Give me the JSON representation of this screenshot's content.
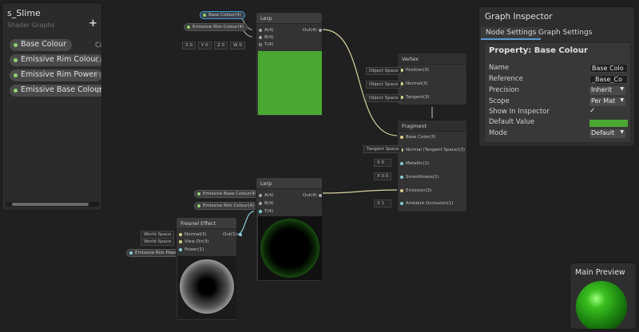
{
  "blackboard": {
    "title": "s_Slime",
    "subtitle": "Shader Graphs",
    "add": "+",
    "properties": [
      {
        "name": "Base Colour",
        "type": "Col"
      },
      {
        "name": "Emissive Rim Colour",
        "type": "Col"
      },
      {
        "name": "Emissive Rim Power",
        "type": "Flo"
      },
      {
        "name": "Emissive Base Colour",
        "type": "Col"
      }
    ]
  },
  "lerp_top": {
    "title": "Lerp",
    "inputs": [
      "A(4)",
      "B(4)",
      "T(4)"
    ],
    "output": "Out(4)",
    "in_a": "Base Colour(4)",
    "in_b": "Emissive Rim Colour(4)",
    "vec": [
      "X",
      "0",
      "Y",
      "0",
      "Z",
      "0",
      "W",
      "0"
    ],
    "preview_color": "#4aa832"
  },
  "vertex": {
    "title": "Vertex",
    "ports": [
      "Position(3)",
      "Normal(3)",
      "Tangent(3)"
    ],
    "spaces": [
      "Object Space",
      "Object Space",
      "Object Space"
    ]
  },
  "fragment": {
    "title": "Fragment",
    "ports": [
      "Base Color(3)",
      "Normal (Tangent Space)(3)",
      "Metallic(1)",
      "Smoothness(1)",
      "Emission(3)",
      "Ambient Occlusion(1)"
    ],
    "normal_space": "Tangent Space",
    "metallic": "0",
    "smoothness": "0.5",
    "ao": "1",
    "x_label": "X"
  },
  "lerp_bottom": {
    "title": "Lerp",
    "inputs": [
      "A(4)",
      "B(4)",
      "T(4)"
    ],
    "output": "Out(4)",
    "in_a": "Emissive Base Colour(4)",
    "in_b": "Emissive Rim Colour(4)"
  },
  "fresnel": {
    "title": "Fresnel Effect",
    "inputs": [
      "Normal(3)",
      "View Dir(3)",
      "Power(1)"
    ],
    "output": "Out(1)",
    "space1": "World Space",
    "space2": "World Space",
    "power_in": "Emissive Rim Power(1)"
  },
  "inspector": {
    "title": "Graph Inspector",
    "tabs": [
      "Node Settings",
      "Graph Settings"
    ],
    "property_header": "Property: Base Colour",
    "rows": [
      {
        "label": "Name",
        "value": "Base Colo"
      },
      {
        "label": "Reference",
        "value": "_Base_Co"
      },
      {
        "label": "Precision",
        "value": "Inherit"
      },
      {
        "label": "Scope",
        "value": "Per Mat"
      },
      {
        "label": "Show In Inspector",
        "value": "✓"
      },
      {
        "label": "Default Value",
        "value": ""
      },
      {
        "label": "Mode",
        "value": "Default"
      }
    ],
    "default_color": "#4aa832"
  },
  "main_preview": {
    "title": "Main Preview"
  },
  "colors": {
    "wire_color": "#d9d4a0",
    "wire_teal": "#86cdd6",
    "accent_blue": "#5a9ad8"
  }
}
